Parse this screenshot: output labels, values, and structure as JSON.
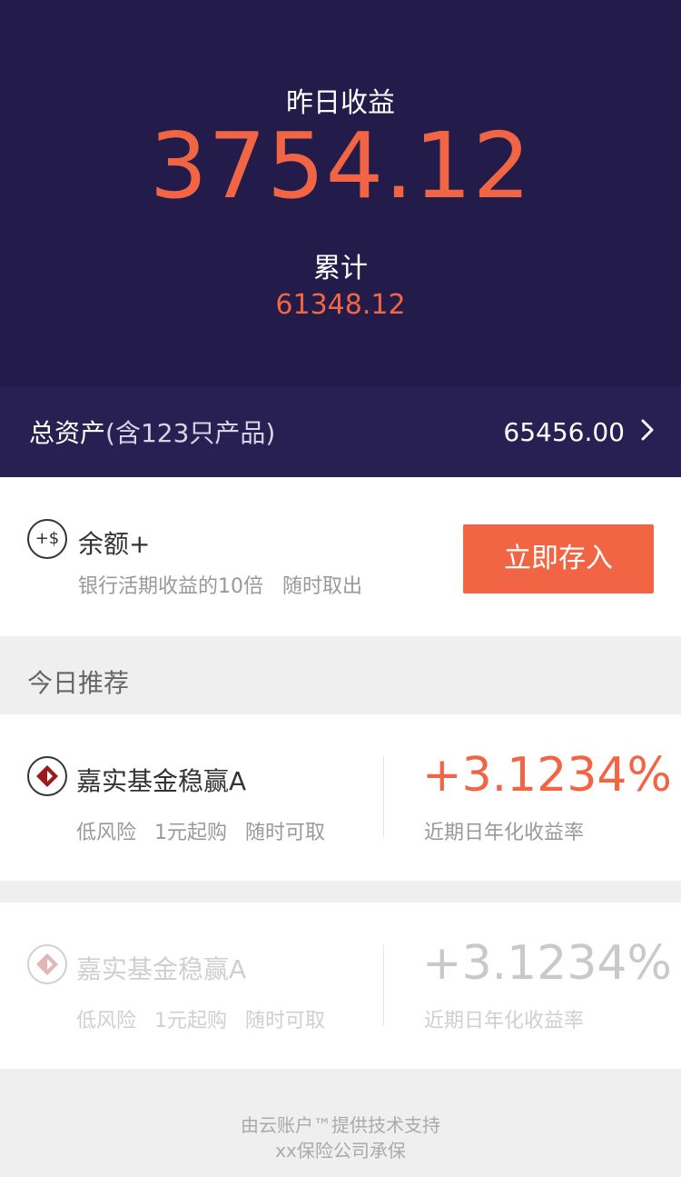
{
  "hero": {
    "yesterday_label": "昨日收益",
    "yesterday_value": "3754.12",
    "cumulative_label": "累计",
    "cumulative_value": "61348.12"
  },
  "total_assets": {
    "label": "总资产",
    "sub_label": "(含123只产品)",
    "value": "65456.00",
    "chevron_icon": "chevron-right-icon"
  },
  "balance_plus": {
    "icon_text": "+$",
    "title": "余额+",
    "description": "银行活期收益的10倍   随时取出",
    "button_label": "立即存入"
  },
  "recommend": {
    "section_title": "今日推荐",
    "items": [
      {
        "name": "嘉实基金稳赢A",
        "tags": [
          "低风险",
          "1元起购",
          "随时可取"
        ],
        "rate": "+3.1234%",
        "rate_label": "近期日年化收益率",
        "enabled": true
      },
      {
        "name": "嘉实基金稳赢A",
        "tags": [
          "低风险",
          "1元起购",
          "随时可取"
        ],
        "rate": "+3.1234%",
        "rate_label": "近期日年化收益率",
        "enabled": false
      }
    ]
  },
  "footer": {
    "line1": "由云账户™提供技术支持",
    "line2": "xx保险公司承保"
  },
  "colors": {
    "hero_bg": "#231b4a",
    "total_bg": "#282053",
    "accent": "#f26544",
    "page_bg": "#efefef"
  }
}
